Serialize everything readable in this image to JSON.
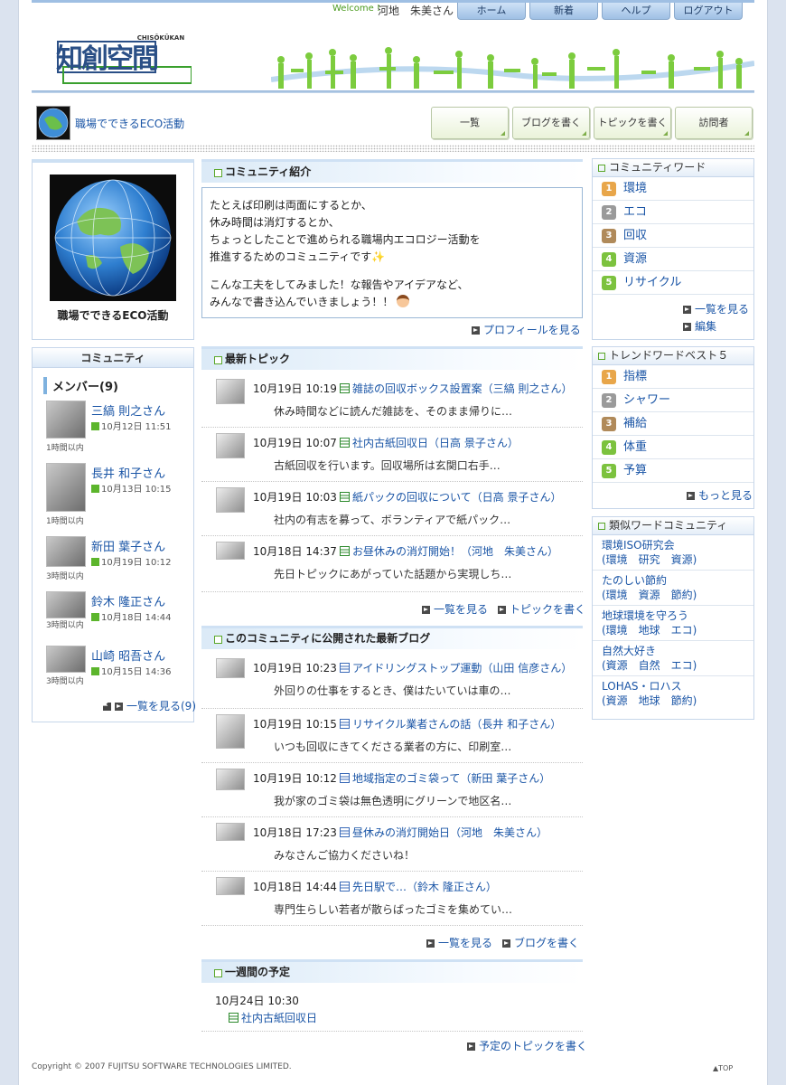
{
  "header": {
    "welcome": "Welcome !",
    "username": "河地　朱美さん",
    "nav": [
      "ホーム",
      "新着",
      "ヘルプ",
      "ログアウト"
    ],
    "logo_text": "知創空間",
    "logo_sub": "CHISŌKŪKAN"
  },
  "community": {
    "name": "職場でできるECO活動",
    "tabs": [
      "一覧",
      "ブログを書く",
      "トピックを書く",
      "訪問者"
    ]
  },
  "left": {
    "community_label": "コミュニティ",
    "members_heading": "メンバー(9)",
    "members": [
      {
        "name": "三縞 則之さん",
        "date": "10月12日 11:51",
        "ago": "1時間以内"
      },
      {
        "name": "長井 和子さん",
        "date": "10月13日 10:15",
        "ago": "1時間以内"
      },
      {
        "name": "新田 葉子さん",
        "date": "10月19日 10:12",
        "ago": "3時間以内"
      },
      {
        "name": "鈴木 隆正さん",
        "date": "10月18日 14:44",
        "ago": "3時間以内"
      },
      {
        "name": "山崎 昭吾さん",
        "date": "10月15日 14:36",
        "ago": "3時間以内"
      }
    ],
    "members_more": "一覧を見る(9)"
  },
  "intro": {
    "heading": "コミュニティ紹介",
    "lines": [
      "たとえば印刷は両面にするとか、",
      "休み時間は消灯するとか、",
      "ちょっとしたことで進められる職場内エコロジー活動を",
      "推進するためのコミュニティです✨",
      "",
      "こんな工夫をしてみました！な報告やアイデアなど、",
      "みんなで書き込んでいきましょう！！"
    ],
    "profile_link": "プロフィールを見る"
  },
  "topics": {
    "heading": "最新トピック",
    "items": [
      {
        "date": "10月19日 10:19",
        "title": "雑誌の回収ボックス設置案（三縞 則之さん）",
        "body": "休み時間などに読んだ雑誌を、そのまま帰りに…"
      },
      {
        "date": "10月19日 10:07",
        "title": "社内古紙回収日（日高 景子さん）",
        "body": "古紙回収を行います。回収場所は玄関口右手…"
      },
      {
        "date": "10月19日 10:03",
        "title": "紙パックの回収について（日高 景子さん）",
        "body": "社内の有志を募って、ボランティアで紙パック…"
      },
      {
        "date": "10月18日 14:37",
        "title": "お昼休みの消灯開始！（河地　朱美さん）",
        "body": "先日トピックにあがっていた話題から実現しち…"
      }
    ],
    "more": "一覧を見る",
    "write": "トピックを書く"
  },
  "blogs": {
    "heading": "このコミュニティに公開された最新ブログ",
    "items": [
      {
        "date": "10月19日 10:23",
        "title": "アイドリングストップ運動（山田 信彦さん）",
        "body": "外回りの仕事をするとき、僕はたいていは車の…"
      },
      {
        "date": "10月19日 10:15",
        "title": "リサイクル業者さんの話（長井 和子さん）",
        "body": "いつも回収にきてくださる業者の方に、印刷室…"
      },
      {
        "date": "10月19日 10:12",
        "title": "地域指定のゴミ袋って（新田 葉子さん）",
        "body": "我が家のゴミ袋は無色透明にグリーンで地区名…"
      },
      {
        "date": "10月18日 17:23",
        "title": "昼休みの消灯開始日（河地　朱美さん）",
        "body": "みなさんご協力くださいね！"
      },
      {
        "date": "10月18日 14:44",
        "title": "先日駅で…（鈴木 隆正さん）",
        "body": "専門生らしい若者が散らばったゴミを集めてい…"
      }
    ],
    "more": "一覧を見る",
    "write": "ブログを書く"
  },
  "schedule": {
    "heading": "一週間の予定",
    "date": "10月24日 10:30",
    "event": "社内古紙回収日",
    "write": "予定のトピックを書く"
  },
  "words": {
    "heading": "コミュニティワード",
    "items": [
      "環境",
      "エコ",
      "回収",
      "資源",
      "リサイクル"
    ],
    "more": "一覧を見る",
    "edit": "編集"
  },
  "trends": {
    "heading": "トレンドワードベスト５",
    "items": [
      "指標",
      "シャワー",
      "補給",
      "体重",
      "予算"
    ],
    "more": "もっと見る"
  },
  "similar": {
    "heading": "類似ワードコミュニティ",
    "items": [
      {
        "name": "環境ISO研究会",
        "tags": "(環境　研究　資源)"
      },
      {
        "name": "たのしい節約",
        "tags": "(環境　資源　節約)"
      },
      {
        "name": "地球環境を守ろう",
        "tags": "(環境　地球　エコ)"
      },
      {
        "name": "自然大好き",
        "tags": "(資源　自然　エコ)"
      },
      {
        "name": "LOHAS・ロハス",
        "tags": "(資源　地球　節約)"
      }
    ]
  },
  "footer": {
    "copyright": "Copyright © 2007 FUJITSU SOFTWARE TECHNOLOGIES LIMITED.",
    "top": "TOP"
  },
  "colors": {
    "link": "#1a55a6",
    "accent_green": "#5aa72a",
    "nav_blue": "#9fc0e5"
  }
}
